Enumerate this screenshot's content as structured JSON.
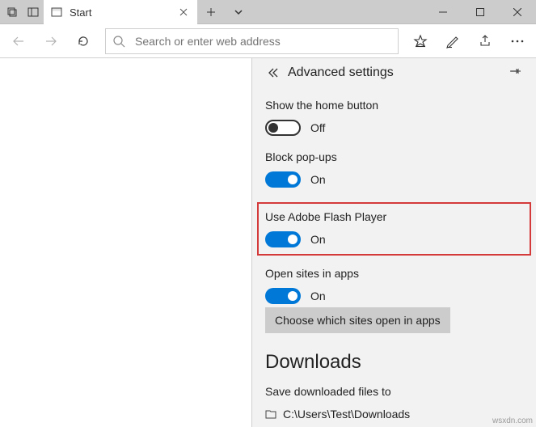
{
  "window": {
    "tab_title": "Start",
    "search_placeholder": "Search or enter web address"
  },
  "panel": {
    "title": "Advanced settings",
    "settings": {
      "home_button": {
        "label": "Show the home button",
        "value": "Off"
      },
      "block_popups": {
        "label": "Block pop-ups",
        "value": "On"
      },
      "flash": {
        "label": "Use Adobe Flash Player",
        "value": "On"
      },
      "open_in_apps": {
        "label": "Open sites in apps",
        "value": "On"
      },
      "choose_sites_button": "Choose which sites open in apps"
    },
    "downloads": {
      "heading": "Downloads",
      "save_label": "Save downloaded files to",
      "path": "C:\\Users\\Test\\Downloads"
    }
  },
  "watermark": "wsxdn.com"
}
